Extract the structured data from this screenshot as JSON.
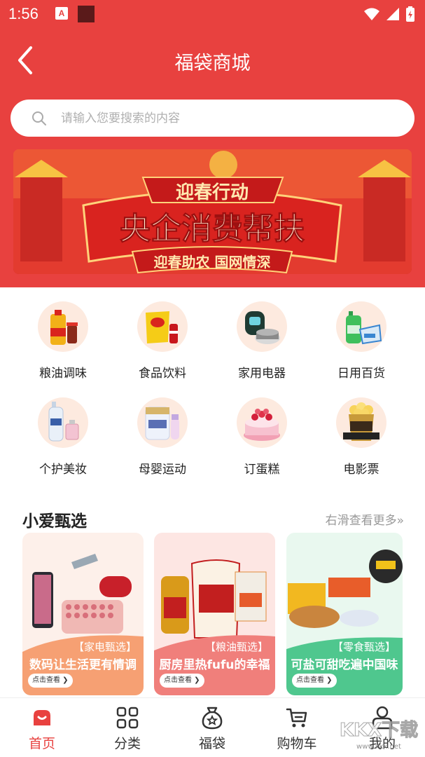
{
  "status_bar": {
    "time": "1:56",
    "app_badge": "A"
  },
  "header": {
    "title": "福袋商城"
  },
  "search": {
    "placeholder": "请输入您要搜索的内容"
  },
  "banner": {
    "kicker": "迎春行动",
    "headline": "央企消费帮扶",
    "ribbon": "迎春助农 国网情深"
  },
  "categories": [
    {
      "label": "粮油调味",
      "icon": "oil-bottle-icon"
    },
    {
      "label": "食品饮料",
      "icon": "snacks-icon"
    },
    {
      "label": "家用电器",
      "icon": "appliance-icon"
    },
    {
      "label": "日用百货",
      "icon": "daily-goods-icon"
    },
    {
      "label": "个护美妆",
      "icon": "cosmetics-icon"
    },
    {
      "label": "母婴运动",
      "icon": "baby-formula-icon"
    },
    {
      "label": "订蛋糕",
      "icon": "cake-icon"
    },
    {
      "label": "电影票",
      "icon": "popcorn-icon"
    }
  ],
  "featured": {
    "title": "小爱甄选",
    "more": "右滑查看更多»",
    "cards": [
      {
        "tag": "【家电甄选】",
        "caption": "数码让生活更有情调",
        "button": "点击查看 ❯",
        "color": "#f6a073"
      },
      {
        "tag": "【粮油甄选】",
        "caption": "厨房里热fufu的幸福",
        "button": "点击查看 ❯",
        "color": "#f07f7b"
      },
      {
        "tag": "【零食甄选】",
        "caption": "可盐可甜吃遍中国味",
        "button": "点击查看 ❯",
        "color": "#4fc78e"
      }
    ]
  },
  "tabs": [
    {
      "label": "首页",
      "icon": "home-icon",
      "active": true
    },
    {
      "label": "分类",
      "icon": "grid-icon",
      "active": false
    },
    {
      "label": "福袋",
      "icon": "lucky-bag-icon",
      "active": false
    },
    {
      "label": "购物车",
      "icon": "cart-icon",
      "active": false
    },
    {
      "label": "我的",
      "icon": "profile-icon",
      "active": false
    }
  ],
  "watermark": {
    "text": "KKX下载",
    "url": "www.kkx.net"
  },
  "colors": {
    "brand_red": "#e8413f",
    "text_dark": "#222222",
    "text_muted": "#999999"
  }
}
